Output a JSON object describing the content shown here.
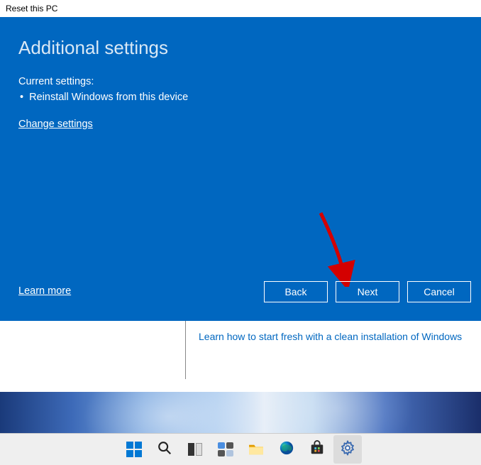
{
  "titlebar": {
    "title": "Reset this PC"
  },
  "dialog": {
    "title": "Additional settings",
    "current_label": "Current settings:",
    "bullets": [
      "Reinstall Windows from this device"
    ],
    "change_link": "Change settings",
    "learn_more": "Learn more",
    "buttons": {
      "back": "Back",
      "next": "Next",
      "cancel": "Cancel"
    }
  },
  "behind": {
    "link": "Learn how to start fresh with a clean installation of Windows"
  },
  "annotation": {
    "arrow_points_to": "next-button",
    "arrow_color": "#d40000"
  }
}
